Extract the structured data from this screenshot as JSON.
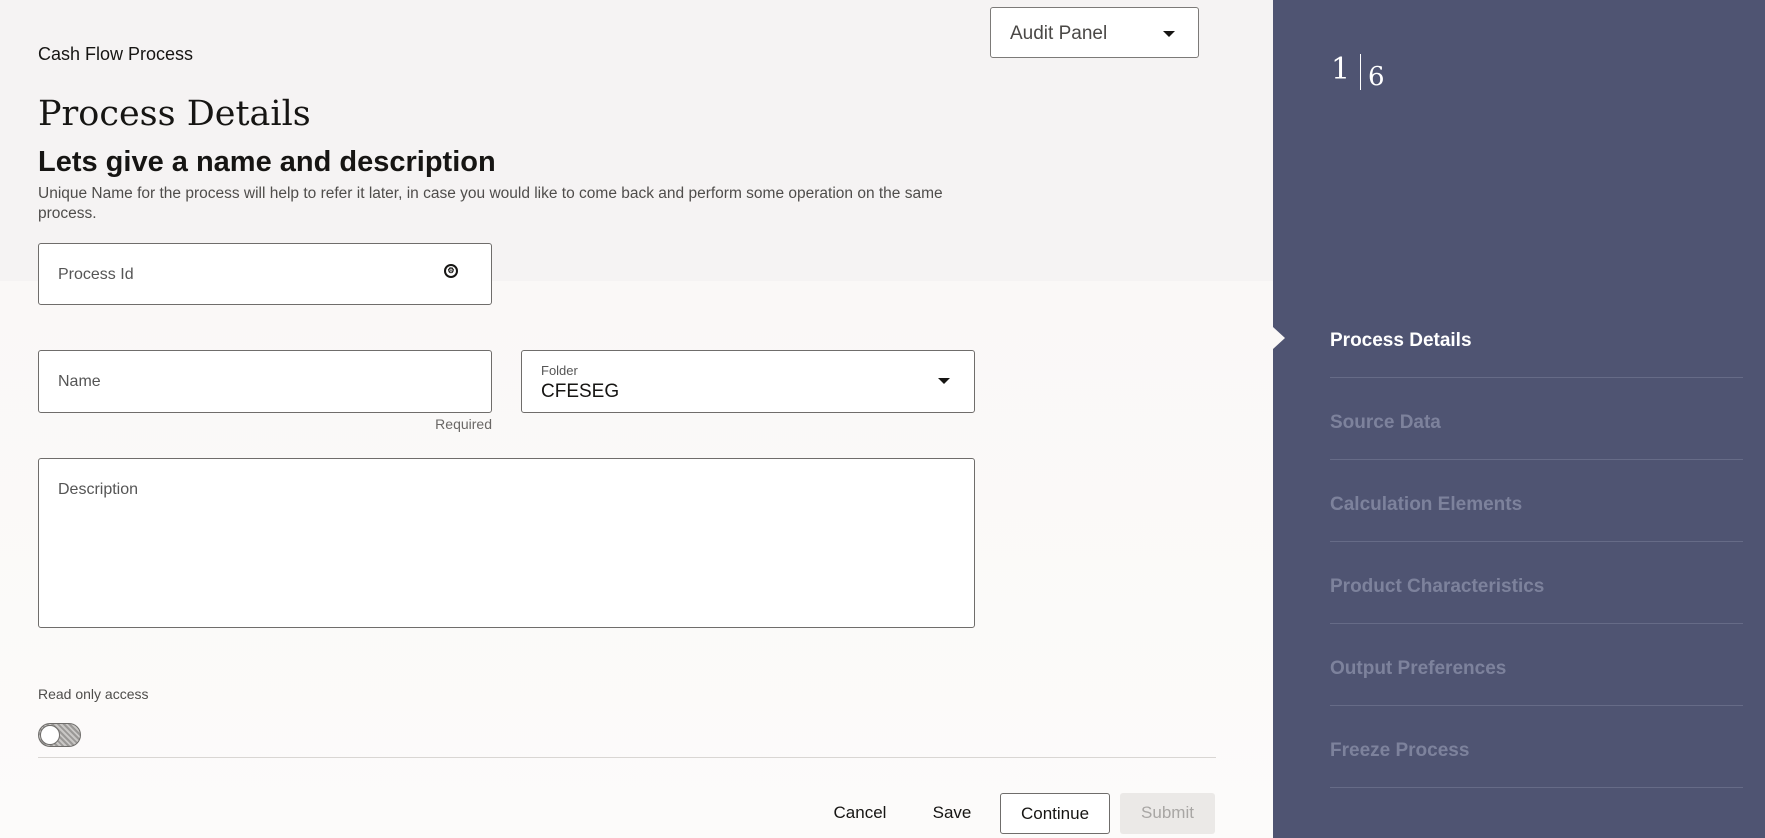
{
  "header": {
    "app_title": "Cash Flow Process",
    "audit_panel": "Audit Panel"
  },
  "main": {
    "page_title": "Process Details",
    "subtitle": "Lets give a name and description",
    "description": "Unique Name for the process will help to refer it later, in case you would like to come back and perform some operation on the same process."
  },
  "form": {
    "process_id": {
      "placeholder": "Process Id",
      "value": ""
    },
    "name": {
      "placeholder": "Name",
      "helper": "Required",
      "value": ""
    },
    "folder": {
      "label": "Folder",
      "value": "CFESEG"
    },
    "description": {
      "placeholder": "Description",
      "value": ""
    },
    "read_only": {
      "label": "Read only access",
      "checked": false
    }
  },
  "actions": {
    "cancel": "Cancel",
    "save": "Save",
    "continue": "Continue",
    "submit": "Submit"
  },
  "sidebar": {
    "current_step": "1",
    "total_steps": "6",
    "steps": [
      {
        "label": "Process Details",
        "active": true
      },
      {
        "label": "Source Data",
        "active": false
      },
      {
        "label": "Calculation Elements",
        "active": false
      },
      {
        "label": "Product Characteristics",
        "active": false
      },
      {
        "label": "Output Preferences",
        "active": false
      },
      {
        "label": "Freeze Process",
        "active": false
      }
    ]
  },
  "colors": {
    "sidebar_bg": "#4f5472",
    "active_step": "#ffffff",
    "inactive_step": "#7d829c"
  },
  "icons": {
    "process_id_field": "process-id-generate-icon",
    "dropdown": "chevron-down-icon"
  }
}
